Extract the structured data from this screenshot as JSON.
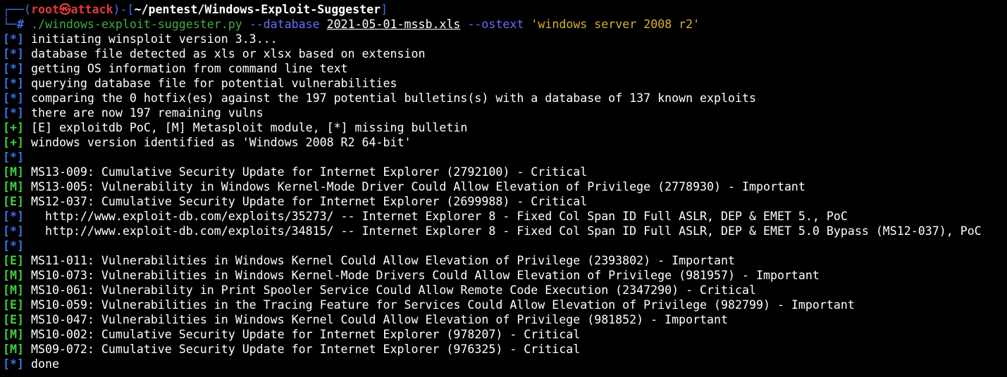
{
  "colors": {
    "background": "#000000",
    "prompt_frame": "#3b73e6",
    "prompt_user": "#e23a3a",
    "script": "#3fae3f",
    "flag": "#6b6bff",
    "string": "#d5b32a",
    "tag_info": "#3b73e6",
    "tag_success": "#3fd13f"
  },
  "prompt": {
    "frame_open": "┌──(",
    "user": "root",
    "skull_icon": "㉿",
    "host": "attack",
    "frame_mid": ")-[",
    "path": "~/pentest/Windows-Exploit-Suggester",
    "frame_close": "]",
    "frame_bottom": "└─",
    "hash": "#"
  },
  "command": {
    "script": "./windows-exploit-suggester.py",
    "flag_database": "--database",
    "database_file": "2021-05-01-mssb.xls",
    "flag_ostext": "--ostext",
    "ostext_value": "'windows server 2008 r2'"
  },
  "output": [
    {
      "tag": "[*]",
      "kind": "info",
      "text": "initiating winsploit version 3.3..."
    },
    {
      "tag": "[*]",
      "kind": "info",
      "text": "database file detected as xls or xlsx based on extension"
    },
    {
      "tag": "[*]",
      "kind": "info",
      "text": "getting OS information from command line text"
    },
    {
      "tag": "[*]",
      "kind": "info",
      "text": "querying database file for potential vulnerabilities"
    },
    {
      "tag": "[*]",
      "kind": "info",
      "text": "comparing the 0 hotfix(es) against the 197 potential bulletins(s) with a database of 137 known exploits"
    },
    {
      "tag": "[*]",
      "kind": "info",
      "text": "there are now 197 remaining vulns"
    },
    {
      "tag": "[+]",
      "kind": "plus",
      "text": "[E] exploitdb PoC, [M] Metasploit module, [*] missing bulletin"
    },
    {
      "tag": "[+]",
      "kind": "plus",
      "text": "windows version identified as 'Windows 2008 R2 64-bit'"
    },
    {
      "tag": "[*]",
      "kind": "info",
      "text": ""
    },
    {
      "tag": "[M]",
      "kind": "m",
      "text": "MS13-009: Cumulative Security Update for Internet Explorer (2792100) - Critical"
    },
    {
      "tag": "[M]",
      "kind": "m",
      "text": "MS13-005: Vulnerability in Windows Kernel-Mode Driver Could Allow Elevation of Privilege (2778930) - Important"
    },
    {
      "tag": "[E]",
      "kind": "e",
      "text": "MS12-037: Cumulative Security Update for Internet Explorer (2699988) - Critical"
    },
    {
      "tag": "[*]",
      "kind": "info",
      "text": "  http://www.exploit-db.com/exploits/35273/ -- Internet Explorer 8 - Fixed Col Span ID Full ASLR, DEP & EMET 5., PoC"
    },
    {
      "tag": "[*]",
      "kind": "info",
      "text": "  http://www.exploit-db.com/exploits/34815/ -- Internet Explorer 8 - Fixed Col Span ID Full ASLR, DEP & EMET 5.0 Bypass (MS12-037), PoC"
    },
    {
      "tag": "[*]",
      "kind": "info",
      "text": ""
    },
    {
      "tag": "[E]",
      "kind": "e",
      "text": "MS11-011: Vulnerabilities in Windows Kernel Could Allow Elevation of Privilege (2393802) - Important"
    },
    {
      "tag": "[M]",
      "kind": "m",
      "text": "MS10-073: Vulnerabilities in Windows Kernel-Mode Drivers Could Allow Elevation of Privilege (981957) - Important"
    },
    {
      "tag": "[M]",
      "kind": "m",
      "text": "MS10-061: Vulnerability in Print Spooler Service Could Allow Remote Code Execution (2347290) - Critical"
    },
    {
      "tag": "[E]",
      "kind": "e",
      "text": "MS10-059: Vulnerabilities in the Tracing Feature for Services Could Allow Elevation of Privilege (982799) - Important"
    },
    {
      "tag": "[E]",
      "kind": "e",
      "text": "MS10-047: Vulnerabilities in Windows Kernel Could Allow Elevation of Privilege (981852) - Important"
    },
    {
      "tag": "[M]",
      "kind": "m",
      "text": "MS10-002: Cumulative Security Update for Internet Explorer (978207) - Critical"
    },
    {
      "tag": "[M]",
      "kind": "m",
      "text": "MS09-072: Cumulative Security Update for Internet Explorer (976325) - Critical"
    },
    {
      "tag": "[*]",
      "kind": "info",
      "text": "done"
    }
  ]
}
